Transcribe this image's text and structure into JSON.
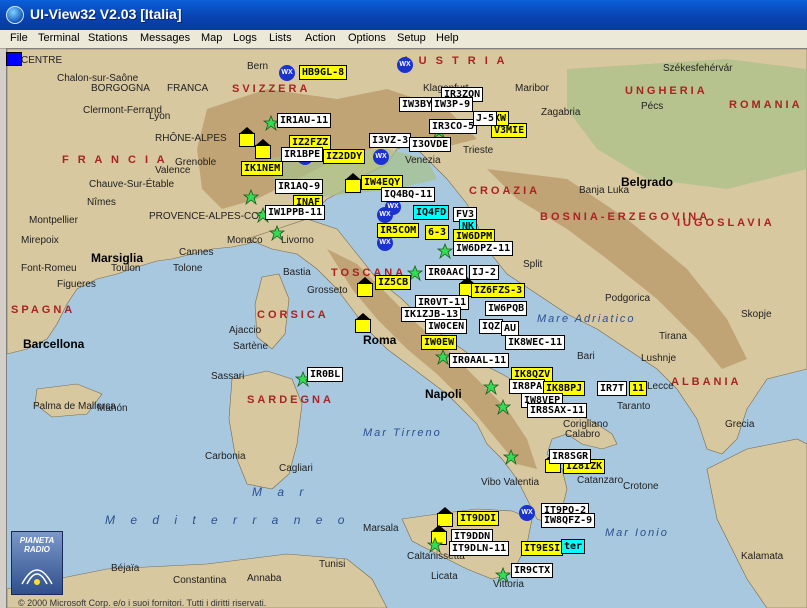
{
  "window": {
    "title": "UI-View32 V2.03 [Italia]"
  },
  "menu": [
    "File",
    "Terminal",
    "Stations",
    "Messages",
    "Map",
    "Logs",
    "Lists",
    "Action",
    "Options",
    "Setup",
    "Help"
  ],
  "map": {
    "colors": {
      "sea": "#a8c8e0",
      "land": "#d8c8a0",
      "mountain": "#b89868",
      "lowland": "#a8c088"
    },
    "labels": {
      "countries": [
        {
          "key": "austria",
          "text": "A U S T R I A"
        },
        {
          "key": "svizzera",
          "text": "SVIZZERA"
        },
        {
          "key": "francia",
          "text": "F R A N C I A"
        },
        {
          "key": "ungheria",
          "text": "UNGHERIA"
        },
        {
          "key": "romania",
          "text": "ROMANIA"
        },
        {
          "key": "croazia",
          "text": "CROAZIA"
        },
        {
          "key": "bosnia",
          "text": "BOSNIA-ERZEGOVINA"
        },
        {
          "key": "iugoslavia",
          "text": "IUGOSLAVIA"
        },
        {
          "key": "albania",
          "text": "ALBANIA"
        },
        {
          "key": "spagna",
          "text": "SPAGNA"
        },
        {
          "key": "corsica",
          "text": "CORSICA"
        },
        {
          "key": "sardegna",
          "text": "SARDEGNA"
        },
        {
          "key": "toscana",
          "text": "TOSCANA"
        }
      ],
      "seas": [
        {
          "key": "adriatico",
          "text": "Mare Adriatico"
        },
        {
          "key": "tirreno",
          "text": "Mar Tirreno"
        },
        {
          "key": "mar",
          "text": "M a r"
        },
        {
          "key": "mediterraneo",
          "text": "M e d i t e r r a n e o"
        },
        {
          "key": "ionio",
          "text": "Mar Ionio"
        }
      ],
      "cities_big": [
        {
          "key": "roma",
          "text": "Roma"
        },
        {
          "key": "napoli",
          "text": "Napoli"
        },
        {
          "key": "barcellona",
          "text": "Barcellona"
        },
        {
          "key": "marsiglia",
          "text": "Marsiglia"
        },
        {
          "key": "belgrado",
          "text": "Belgrado"
        }
      ],
      "cities": [
        {
          "key": "centre",
          "text": "CENTRE"
        },
        {
          "key": "borgogna",
          "text": "BORGOGNA"
        },
        {
          "key": "franca",
          "text": "FRANCA"
        },
        {
          "key": "chalon",
          "text": "Chalon-sur-Saône"
        },
        {
          "key": "bern",
          "text": "Bern"
        },
        {
          "key": "clermont",
          "text": "Clermont-Ferrand"
        },
        {
          "key": "rhone",
          "text": "RHÔNE-ALPES"
        },
        {
          "key": "lyon",
          "text": "Lyon"
        },
        {
          "key": "grenoble",
          "text": "Grenoble"
        },
        {
          "key": "valence",
          "text": "Valence"
        },
        {
          "key": "chauve",
          "text": "Chauve-Sur-Étable"
        },
        {
          "key": "nimes",
          "text": "Nîmes"
        },
        {
          "key": "montpellier",
          "text": "Montpellier"
        },
        {
          "key": "provence",
          "text": "PROVENCE-ALPES-COTE"
        },
        {
          "key": "mirepoix",
          "text": "Mirepoix"
        },
        {
          "key": "monaco",
          "text": "Monaco"
        },
        {
          "key": "livorno",
          "text": "Livorno"
        },
        {
          "key": "venezia",
          "text": "Venezia"
        },
        {
          "key": "trieste",
          "text": "Trieste"
        },
        {
          "key": "klagenfurt",
          "text": "Klagenfurt"
        },
        {
          "key": "maribor",
          "text": "Maribor"
        },
        {
          "key": "zagabria",
          "text": "Zagabria"
        },
        {
          "key": "pecs",
          "text": "Pécs"
        },
        {
          "key": "szekesfehervar",
          "text": "Székesfehérvár"
        },
        {
          "key": "banja",
          "text": "Banja Luka"
        },
        {
          "key": "split",
          "text": "Split"
        },
        {
          "key": "font",
          "text": "Font-Romeu"
        },
        {
          "key": "figueres",
          "text": "Figueres"
        },
        {
          "key": "toulon",
          "text": "Toulon"
        },
        {
          "key": "toulone",
          "text": "Tolone"
        },
        {
          "key": "cannes",
          "text": "Cannes"
        },
        {
          "key": "grosseto",
          "text": "Grosseto"
        },
        {
          "key": "bastia",
          "text": "Bastia"
        },
        {
          "key": "ajaccio",
          "text": "Ajaccio"
        },
        {
          "key": "sartene",
          "text": "Sartène"
        },
        {
          "key": "sassari",
          "text": "Sassari"
        },
        {
          "key": "palma",
          "text": "Palma de Mallorca"
        },
        {
          "key": "mahon",
          "text": "Mahón"
        },
        {
          "key": "carbonia",
          "text": "Carbonia"
        },
        {
          "key": "cagliari",
          "text": "Cagliari"
        },
        {
          "key": "bari",
          "text": "Bari"
        },
        {
          "key": "taranto",
          "text": "Taranto"
        },
        {
          "key": "lecce",
          "text": "Lecce"
        },
        {
          "key": "corigliano",
          "text": "Corigliano"
        },
        {
          "key": "calabro",
          "text": "Calabro"
        },
        {
          "key": "catanzaro",
          "text": "Catanzaro"
        },
        {
          "key": "vibo",
          "text": "Vibo Valentia"
        },
        {
          "key": "crotone",
          "text": "Crotone"
        },
        {
          "key": "podgorica",
          "text": "Podgorica"
        },
        {
          "key": "skopje",
          "text": "Skopje"
        },
        {
          "key": "lushnje",
          "text": "Lushnje"
        },
        {
          "key": "tirana",
          "text": "Tirana"
        },
        {
          "key": "grecia",
          "text": "Grecia"
        },
        {
          "key": "kalamata",
          "text": "Kalamata"
        },
        {
          "key": "marsala",
          "text": "Marsala"
        },
        {
          "key": "caltanissetta",
          "text": "Caltanissetta"
        },
        {
          "key": "licata",
          "text": "Licata"
        },
        {
          "key": "vittoria",
          "text": "Vittoria"
        },
        {
          "key": "tunisi",
          "text": "Tunisi"
        },
        {
          "key": "bejaia",
          "text": "Béjaïa"
        },
        {
          "key": "constantina",
          "text": "Constantina"
        },
        {
          "key": "annaba",
          "text": "Annaba"
        }
      ]
    },
    "stations": [
      {
        "call": "HB9GL-8",
        "style": "yellow"
      },
      {
        "call": "IR3ZON",
        "style": "white"
      },
      {
        "call": "IW3BYL-9",
        "style": "white"
      },
      {
        "call": "IW3P-9",
        "style": "white"
      },
      {
        "call": "IR3CO-5",
        "style": "white"
      },
      {
        "call": "V3MIE",
        "style": "yellow"
      },
      {
        "call": "XW",
        "style": "yellow"
      },
      {
        "call": "J-5",
        "style": "white"
      },
      {
        "call": "IR1AU-11",
        "style": "white"
      },
      {
        "call": "IZ2FZZ",
        "style": "yellow"
      },
      {
        "call": "IR1BPE",
        "style": "white"
      },
      {
        "call": "IZ2DDY",
        "style": "yellow"
      },
      {
        "call": "I3VZ-3",
        "style": "white"
      },
      {
        "call": "I3OVDE",
        "style": "white"
      },
      {
        "call": "IK1NEM",
        "style": "yellow"
      },
      {
        "call": "IW4EQY",
        "style": "yellow"
      },
      {
        "call": "IR1AQ-9",
        "style": "white"
      },
      {
        "call": "IQ4BQ-11",
        "style": "white"
      },
      {
        "call": "INAF",
        "style": "yellow"
      },
      {
        "call": "IW1PPB-11",
        "style": "white"
      },
      {
        "call": "IQ4FD",
        "style": "cyan"
      },
      {
        "call": "FV3",
        "style": "white"
      },
      {
        "call": "IR5COM",
        "style": "yellow"
      },
      {
        "call": "6-3",
        "style": "yellow"
      },
      {
        "call": "NK",
        "style": "cyan"
      },
      {
        "call": "IW6DPM",
        "style": "yellow"
      },
      {
        "call": "IW6DPZ-11",
        "style": "white"
      },
      {
        "call": "IR0AAC",
        "style": "white"
      },
      {
        "call": "IJ-2",
        "style": "white"
      },
      {
        "call": "IZ5CB",
        "style": "yellow"
      },
      {
        "call": "IZ6FZS-3",
        "style": "yellow"
      },
      {
        "call": "IR0VT-11",
        "style": "white"
      },
      {
        "call": "IW6PQB",
        "style": "white"
      },
      {
        "call": "IK1ZJB-13",
        "style": "white"
      },
      {
        "call": "IW0CEN",
        "style": "white"
      },
      {
        "call": "IQZ",
        "style": "white"
      },
      {
        "call": "AU",
        "style": "white"
      },
      {
        "call": "IW0EW",
        "style": "yellow"
      },
      {
        "call": "IK8WEC-11",
        "style": "white"
      },
      {
        "call": "IR0AAL-11",
        "style": "white"
      },
      {
        "call": "IR0BL",
        "style": "white"
      },
      {
        "call": "IK8QZV",
        "style": "yellow"
      },
      {
        "call": "IR8PA",
        "style": "white"
      },
      {
        "call": "IK8BPJ",
        "style": "yellow"
      },
      {
        "call": "IR7T",
        "style": "white"
      },
      {
        "call": "11",
        "style": "yellow"
      },
      {
        "call": "IW8VEP",
        "style": "white"
      },
      {
        "call": "IR8SAX-11",
        "style": "white"
      },
      {
        "call": "IZ8IZK",
        "style": "yellow"
      },
      {
        "call": "IR8SGR",
        "style": "white"
      },
      {
        "call": "IT9DDI",
        "style": "yellow"
      },
      {
        "call": "IT9PO-2",
        "style": "white"
      },
      {
        "call": "IW8QFZ-9",
        "style": "white"
      },
      {
        "call": "IT9DDN",
        "style": "white"
      },
      {
        "call": "IT9DLN-11",
        "style": "white"
      },
      {
        "call": "IT9ESI",
        "style": "yellow"
      },
      {
        "call": "ter",
        "style": "cyan"
      },
      {
        "call": "IR9CTX",
        "style": "white"
      }
    ],
    "logo_text": "PIANETA RADIO",
    "copyright": "© 2000 Microsoft Corp. e/o i suoi fornitori. Tutti i diritti riservati."
  }
}
